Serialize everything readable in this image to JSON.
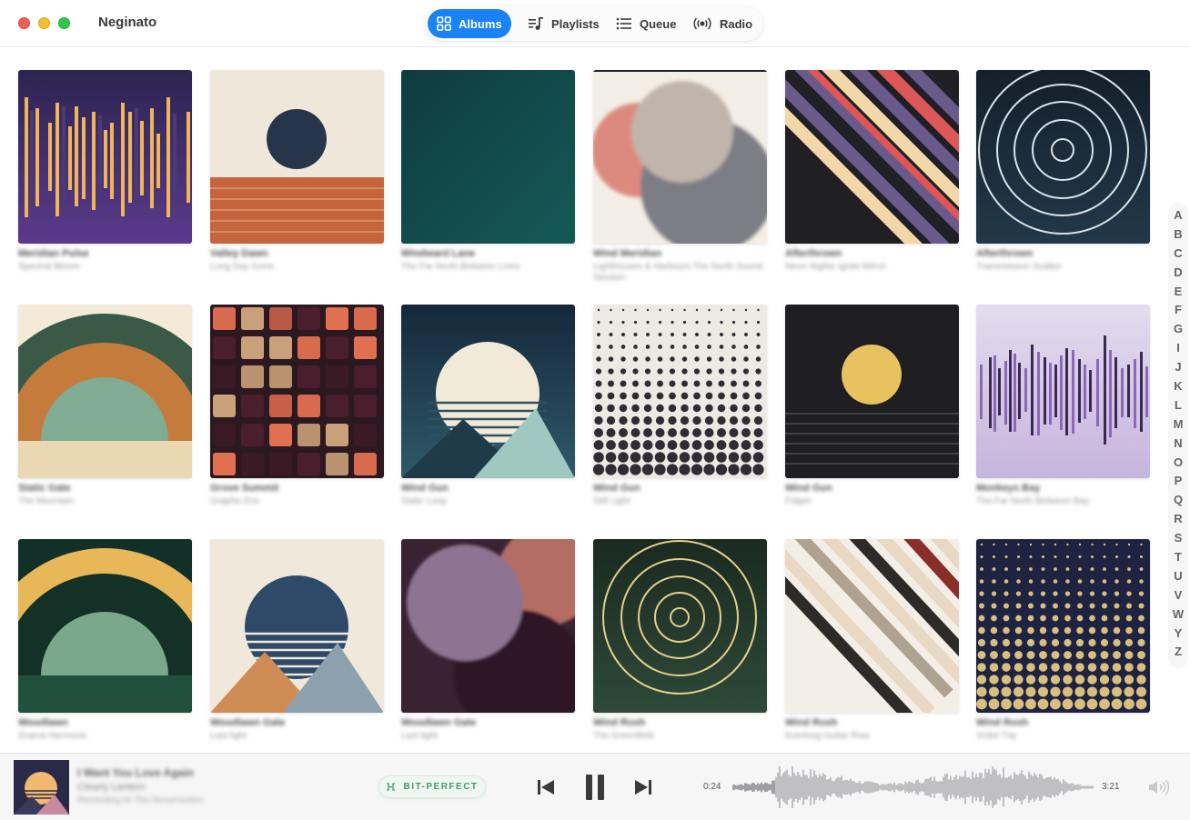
{
  "app": {
    "title": "Neginato"
  },
  "nav": [
    {
      "label": "Albums",
      "icon": "grid-icon",
      "active": true
    },
    {
      "label": "Playlists",
      "icon": "music-note-list-icon",
      "active": false
    },
    {
      "label": "Queue",
      "icon": "list-icon",
      "active": false
    },
    {
      "label": "Radio",
      "icon": "broadcast-icon",
      "active": false
    }
  ],
  "albums": [
    {
      "title": "Meridian Pulse",
      "subtitle": "Spectral Bloom",
      "art": "purple-bars"
    },
    {
      "title": "Valley Dawn",
      "subtitle": "Long Day Gone",
      "art": "sunset-stripes"
    },
    {
      "title": "Windward Lane",
      "subtitle": "The Far North Between Lines",
      "art": "teal-solid"
    },
    {
      "title": "Wind Meridian",
      "subtitle": "Lighthouses & Harbours The North Sound Session",
      "art": "blurred-circles"
    },
    {
      "title": "Afterthrown",
      "subtitle": "Neon Nights Ignite Mirror",
      "art": "diagonal-stripes"
    },
    {
      "title": "Afterthrown",
      "subtitle": "Transmission Scatter",
      "art": "target-rings"
    },
    {
      "title": "Static Gate",
      "subtitle": "The Mountain",
      "art": "green-arch"
    },
    {
      "title": "Grove Summit",
      "subtitle": "Graphic Era",
      "art": "tile-grid"
    },
    {
      "title": "Wind Gun",
      "subtitle": "Static Loop",
      "art": "moon-mountains"
    },
    {
      "title": "Wind Gun",
      "subtitle": "Still Light",
      "art": "dot-gradient"
    },
    {
      "title": "Wind Gun",
      "subtitle": "Fidget",
      "art": "yellow-moon"
    },
    {
      "title": "Monkeys Bay",
      "subtitle": "The Far North Between Bay",
      "art": "lavender-bars"
    },
    {
      "title": "Woodlawn",
      "subtitle": "Drama Harmonic",
      "art": "gold-arch"
    },
    {
      "title": "Woodlawn Gate",
      "subtitle": "Last light",
      "art": "blue-sun-mountains"
    },
    {
      "title": "Woodlawn Gate",
      "subtitle": "Last light",
      "art": "mauve-blur"
    },
    {
      "title": "Wind Rush",
      "subtitle": "The Greenfield",
      "art": "gold-rings"
    },
    {
      "title": "Wind Rush",
      "subtitle": "Everlong Guitar Row",
      "art": "red-diagonals"
    },
    {
      "title": "Wind Rush",
      "subtitle": "Violet Trip",
      "art": "gold-dots"
    }
  ],
  "alphabet": [
    "A",
    "B",
    "C",
    "D",
    "E",
    "F",
    "G",
    "I",
    "J",
    "K",
    "L",
    "M",
    "N",
    "O",
    "P",
    "Q",
    "R",
    "S",
    "T",
    "U",
    "V",
    "W",
    "Y",
    "Z"
  ],
  "player": {
    "track": "I Want You Love Again",
    "artist": "Clearly Lantern",
    "album": "Reminding At The Resurrection",
    "badge": "BIT-PERFECT",
    "elapsed": "0:24",
    "total": "3:21",
    "progress": 0.12,
    "state": "playing"
  }
}
